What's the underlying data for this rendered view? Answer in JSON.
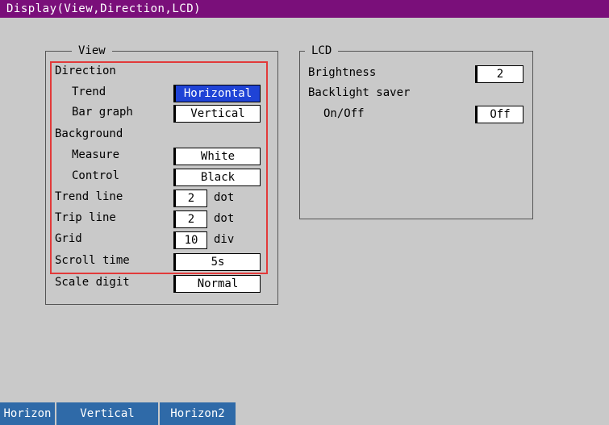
{
  "title": "Display(View,Direction,LCD)",
  "view_group": {
    "title": "View",
    "direction_header": "Direction",
    "trend_label": "Trend",
    "trend_value": "Horizontal",
    "bar_graph_label": "Bar graph",
    "bar_graph_value": "Vertical",
    "background_header": "Background",
    "measure_label": "Measure",
    "measure_value": "White",
    "control_label": "Control",
    "control_value": "Black",
    "trend_line_label": "Trend line",
    "trend_line_value": "2",
    "trend_line_unit": "dot",
    "trip_line_label": "Trip line",
    "trip_line_value": "2",
    "trip_line_unit": "dot",
    "grid_label": "Grid",
    "grid_value": "10",
    "grid_unit": "div",
    "scroll_time_label": "Scroll time",
    "scroll_time_value": "5s",
    "scale_digit_label": "Scale digit",
    "scale_digit_value": "Normal"
  },
  "lcd_group": {
    "title": "LCD",
    "brightness_label": "Brightness",
    "brightness_value": "2",
    "backlight_label": "Backlight saver",
    "onoff_label": "On/Off",
    "onoff_value": "Off"
  },
  "softkeys": [
    "Horizon",
    "Vertical",
    "Horizon2"
  ],
  "colors": {
    "title_bar": "#7a0f7a",
    "selected": "#1f43d6",
    "highlight_box": "#e23a3a",
    "softkey": "#2f6aa8"
  }
}
